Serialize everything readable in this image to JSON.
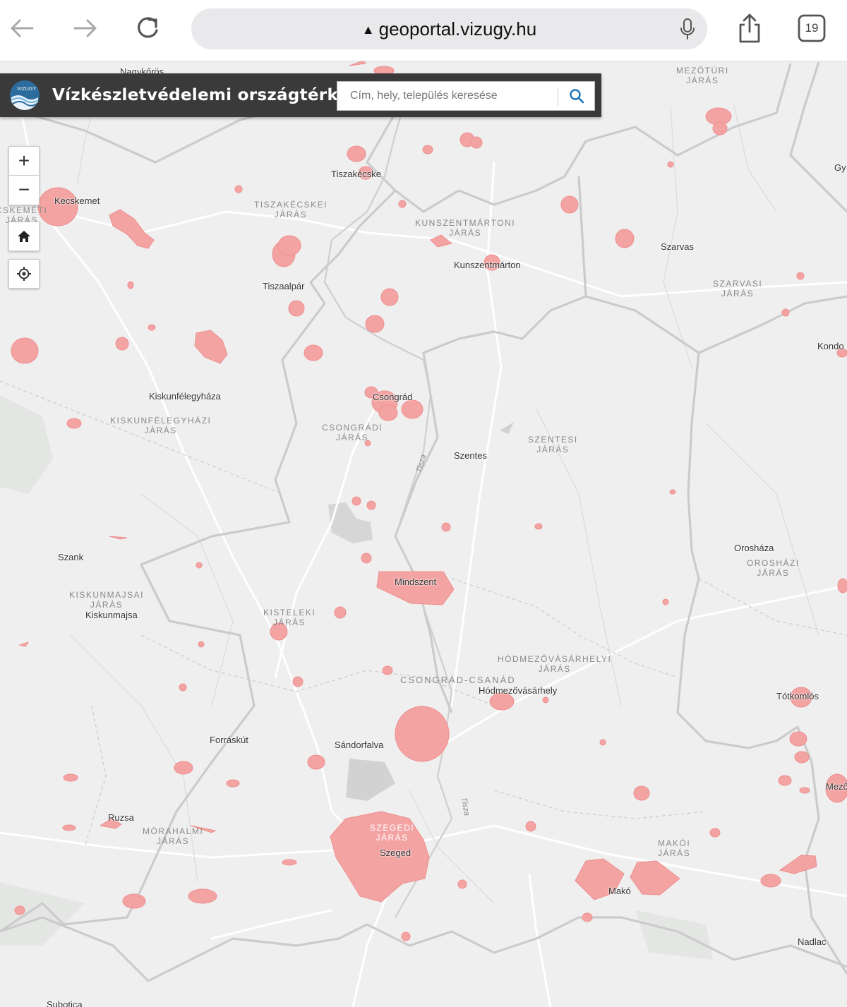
{
  "browser": {
    "url": "geoportal.vizugy.hu",
    "tab_count": "19"
  },
  "app": {
    "title": "Vízkészletvédelemi országtérkép",
    "logo_text": "VIZUGY",
    "search_placeholder": "Cím, hely, település keresése"
  },
  "controls": {
    "zoom_in": "+",
    "zoom_out": "−"
  },
  "map": {
    "places": {
      "nagykoros": "Nagykőrös",
      "mezotur": "MEZŐTÚRI\nJÁRÁS",
      "tiszakecske": "Tiszakécske",
      "kecskemet": "Kecskemet",
      "kecskemeti_jaras": "CSKEMÉTI\nJÁRÁS",
      "tiszakecskei_jaras": "TISZAKÉCSKEI\nJÁRÁS",
      "kunszentmartoni_jaras": "KUNSZENTMÁRTONI\nJÁRÁS",
      "kunszentmarton": "Kunszentmárton",
      "szarvas": "Szarvas",
      "szarvasi_jaras": "SZARVASI\nJÁRÁS",
      "tiszaalpar": "Tiszaalpár",
      "kondoros": "Kondo",
      "gyoma": "Gy",
      "kiskunfelegyhaza": "Kiskunfélegyháza",
      "kiskunfelegyhazi_jaras": "KISKUNFÉLEGYHÁZI\nJÁRÁS",
      "csongrad": "Csongrád",
      "csongradi_jaras": "CSONGRÁDI\nJÁRÁS",
      "szentesi_jaras": "SZENTESI\nJÁRÁS",
      "szentes": "Szentes",
      "tisza1": "Tisza",
      "szank": "Szank",
      "oroshaza": "Orosháza",
      "oroshazi_jaras": "OROSHÁZI\nJÁRÁS",
      "mindszent": "Mindszent",
      "kiskunmajsai_jaras": "KISKUNMAJSAI\nJÁRÁS",
      "kiskunmajsa": "Kiskunmajsa",
      "kisteleki_jaras": "KISTELEKI\nJÁRÁS",
      "hodmezovasarhelyi_jaras": "HÓDMEZŐVÁSÁRHELYI\nJÁRÁS",
      "csongrad_csanad": "CSONGRÁD-CSANÁD",
      "hodmezovasarhely": "Hódmezővásárhely",
      "totkomlos": "Tótkomlós",
      "forraskut": "Forráskút",
      "sandorfalva": "Sándorfalva",
      "mezohegyes": "Mező",
      "tisza2": "Tisza",
      "ruzsa": "Ruzsa",
      "morahalmi_jaras": "MÓRAHALMI\nJÁRÁS",
      "szegedi_jaras": "SZEGEDI\nJÁRÁS",
      "szeged": "Szeged",
      "makoi_jaras": "MAKÓI\nJÁRÁS",
      "mako": "Makó",
      "nadlac": "Nadlac",
      "subotica": "Subotica"
    },
    "colors": {
      "background": "#efefef",
      "protection_zone": "#f4a3a3",
      "protection_zone_edge": "#ee8e8e",
      "border": "#c8c8c8",
      "road": "#ffffff",
      "header": "#3a3a3a",
      "accent": "#1a73b8"
    },
    "icons": [
      "back-arrow-icon",
      "forward-arrow-icon",
      "reload-icon",
      "warning-icon",
      "microphone-icon",
      "share-icon",
      "tabs-icon",
      "search-icon",
      "home-icon",
      "locate-icon"
    ]
  }
}
